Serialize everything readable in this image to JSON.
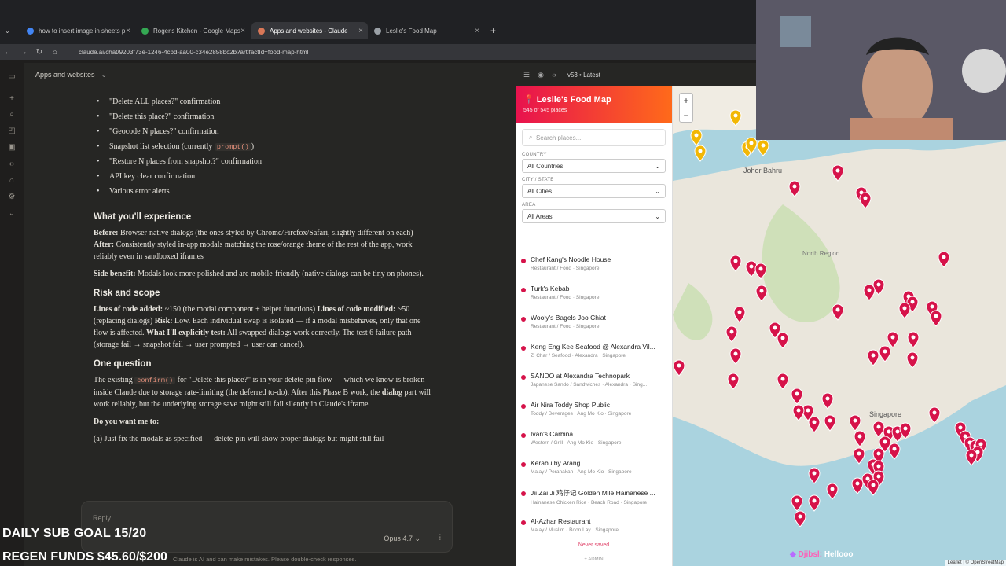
{
  "browser": {
    "tabs": [
      {
        "label": "how to insert image in sheets p",
        "color": "#4285f4"
      },
      {
        "label": "Roger's Kitchen - Google Maps",
        "color": "#34a853"
      },
      {
        "label": "Apps and websites - Claude",
        "color": "#d97757"
      },
      {
        "label": "Leslie's Food Map",
        "color": "#9aa0a6"
      }
    ],
    "url": "claude.ai/chat/9203f73e-1246-4cbd-aa00-c34e2858bc2b?artifactId=food-map-html"
  },
  "app": {
    "title": "Apps and websites",
    "bullets": [
      "\"Delete ALL places?\" confirmation",
      "\"Delete this place?\" confirmation",
      "\"Geocode N places?\" confirmation",
      "Snapshot list selection (currently ",
      "\"Restore N places from snapshot?\" confirmation",
      "API key clear confirmation",
      "Various error alerts"
    ],
    "bullet_code": "prompt()",
    "bullet_code_after": ")",
    "h_experience": "What you'll experience",
    "before_label": "Before:",
    "before_text": " Browser-native dialogs (the ones styled by Chrome/Firefox/Safari, slightly different on each) ",
    "after_label": "After:",
    "after_text": " Consistently styled in-app modals matching the rose/orange theme of the rest of the app, work reliably even in sandboxed iframes",
    "side_label": "Side benefit:",
    "side_text": " Modals look more polished and are mobile-friendly (native dialogs can be tiny on phones).",
    "h_risk": "Risk and scope",
    "loc_added_label": "Lines of code added:",
    "loc_added_text": " ~150 (the modal component + helper functions) ",
    "loc_mod_label": "Lines of code modified:",
    "loc_mod_text": " ~50 (replacing dialogs) ",
    "risk_label": "Risk:",
    "risk_text": " Low. Each individual swap is isolated — if a modal misbehaves, only that one flow is affected. ",
    "test_label": "What I'll explicitly test:",
    "test_text": " All swapped dialogs work correctly. The test 6 failure path (storage fail → snapshot fail → user prompted → user can cancel).",
    "h_question": "One question",
    "q_pre": "The existing ",
    "q_code": "confirm()",
    "q_post": " for \"Delete this place?\" is in your delete-pin flow — which we know is broken inside Claude due to storage rate-limiting (the deferred to-do). After this Phase B work, the ",
    "q_bold": "dialog",
    "q_end": " part will work reliably, but the underlying storage save might still fail silently in Claude's iframe.",
    "want_label": "Do you want me to:",
    "option_a": "(a) Just fix the modals as specified — delete-pin will show proper dialogs but might still fail",
    "reply_placeholder": "Reply...",
    "model": "Opus 4.7",
    "disclaimer": "Claude is AI and can make mistakes. Please double-check responses."
  },
  "overlay": {
    "sub_goal": "DAILY SUB GOAL 15/20",
    "regen": "REGEN FUNDS $45.60/$200",
    "chat_user": "Djibsl:",
    "chat_msg": "Hellooo"
  },
  "artifact": {
    "version": "v53 • Latest",
    "title": "Leslie's Food Map",
    "count": "545 of 545 places",
    "search_placeholder": "Search places...",
    "country_label": "COUNTRY",
    "country_value": "All Countries",
    "city_label": "CITY / STATE",
    "city_value": "All Cities",
    "area_label": "AREA",
    "area_value": "All Areas",
    "places": [
      {
        "name": "Chef Kang's Noodle House",
        "meta": "Restaurant / Food · Singapore"
      },
      {
        "name": "Turk's Kebab",
        "meta": "Restaurant / Food · Singapore"
      },
      {
        "name": "Wooly's Bagels Joo Chiat",
        "meta": "Restaurant / Food · Singapore"
      },
      {
        "name": "Keng Eng Kee Seafood @ Alexandra Vil...",
        "meta": "Zi Char / Seafood · Alexandra · Singapore"
      },
      {
        "name": "SANDO at Alexandra Technopark",
        "meta": "Japanese Sando / Sandwiches · Alexandra · Sing..."
      },
      {
        "name": "Air Nira Toddy Shop Public",
        "meta": "Toddy / Beverages · Ang Mo Kio · Singapore"
      },
      {
        "name": "Ivan's Carbina",
        "meta": "Western / Grill · Ang Mo Kio · Singapore"
      },
      {
        "name": "Kerabu by Arang",
        "meta": "Malay / Peranakan · Ang Mo Kio · Singapore"
      },
      {
        "name": "Jii Zai Ji 鸡仔记 Golden Mile Hainanese ...",
        "meta": "Hainanese Chicken Rice · Beach Road · Singapore"
      },
      {
        "name": "Al-Azhar Restaurant",
        "meta": "Malay / Muslim · Boon Lay · Singapore"
      }
    ],
    "never_saved": "Never saved",
    "admin": "+ ADMIN",
    "map_labels": [
      "Johor Bahru",
      "North Region",
      "Singapore"
    ],
    "attribution": "Leaflet | © OpenStreetMap",
    "pin_color": "#d6134a",
    "gold_pin_color": "#f2b705"
  }
}
